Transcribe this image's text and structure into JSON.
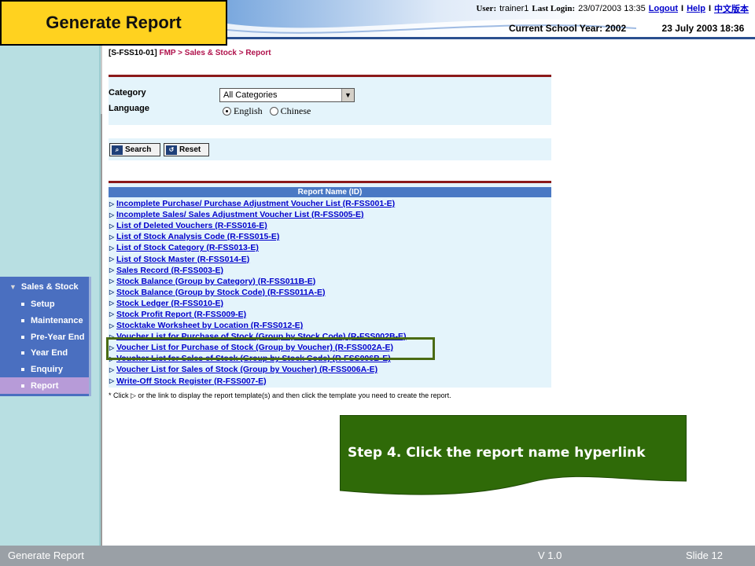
{
  "slide_title": "Generate Report",
  "header": {
    "user_label": "User:",
    "user_name": "trainer1",
    "last_login_label": "Last Login:",
    "last_login_value": "23/07/2003 13:35",
    "logout_link": "Logout",
    "help_link": "Help",
    "chinese_link": "中文版本",
    "separator": "I",
    "school_year": "Current School Year: 2002",
    "current_datetime": "23 July 2003 18:36"
  },
  "breadcrumb": {
    "code": "[S-FSS10-01]",
    "path": "FMP > Sales & Stock > Report"
  },
  "form": {
    "category_label": "Category",
    "category_value": "All Categories",
    "language_label": "Language",
    "lang_english": "English",
    "lang_chinese": "Chinese",
    "search_button": "Search",
    "reset_button": "Reset"
  },
  "report_table": {
    "header": "Report Name (ID)",
    "rows": [
      "Incomplete Purchase/ Purchase Adjustment Voucher List (R-FSS001-E)",
      "Incomplete Sales/ Sales Adjustment Voucher List (R-FSS005-E)",
      "List of Deleted Vouchers (R-FSS016-E)",
      "List of Stock Analysis Code (R-FSS015-E)",
      "List of Stock Category (R-FSS013-E)",
      "List of Stock Master (R-FSS014-E)",
      "Sales Record (R-FSS003-E)",
      "Stock Balance (Group by Category) (R-FSS011B-E)",
      "Stock Balance (Group by Stock Code) (R-FSS011A-E)",
      "Stock Ledger (R-FSS010-E)",
      "Stock Profit Report (R-FSS009-E)",
      "Stocktake Worksheet by Location (R-FSS012-E)",
      "Voucher List for Purchase of Stock (Group by Stock Code) (R-FSS002B-E)",
      "Voucher List for Purchase of Stock (Group by Voucher) (R-FSS002A-E)",
      "Voucher List for Sales of Stock (Group by Stock Code) (R-FSS006B-E)",
      "Voucher List for Sales of Stock (Group by Voucher) (R-FSS006A-E)",
      "Write-Off Stock Register (R-FSS007-E)"
    ],
    "note": "* Click ▷ or the link to display the report template(s) and then click the template you need to create the report."
  },
  "nav": {
    "section": "Sales & Stock",
    "items": [
      "Setup",
      "Maintenance",
      "Pre-Year End",
      "Year End",
      "Enquiry",
      "Report"
    ],
    "active_index": 5
  },
  "callout_text": "Step 4. Click the report name hyperlink",
  "footer": {
    "left": "Generate Report",
    "version": "V 1.0",
    "slide": "Slide 12"
  },
  "colors": {
    "title_bg": "#ffd21f",
    "callout_bg": "#2f6a08",
    "nav_bg": "#4a6fc0",
    "nav_active": "#b79bd8",
    "highlight_border": "#4a6b13",
    "link": "#0000cc"
  }
}
